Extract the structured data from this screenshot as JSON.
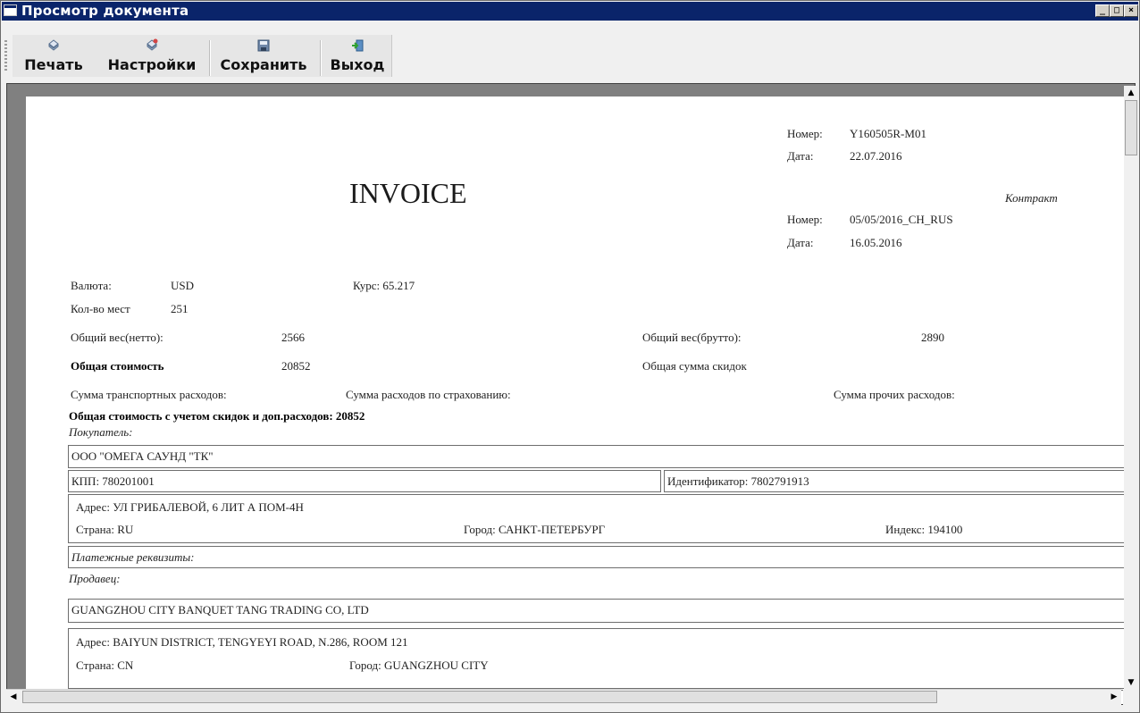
{
  "window": {
    "title": "Просмотр документа"
  },
  "toolbar": {
    "print": "Печать",
    "settings": "Настройки",
    "save": "Сохранить",
    "exit": "Выход"
  },
  "doc": {
    "title": "INVOICE",
    "number_label": "Номер:",
    "number": "Y160505R-M01",
    "date_label": "Дата:",
    "date": "22.07.2016",
    "contract_label": "Контракт",
    "contract_number_label": "Номер:",
    "contract_number": "05/05/2016_CH_RUS",
    "contract_date_label": "Дата:",
    "contract_date": "16.05.2016",
    "currency_label": "Валюта:",
    "currency": "USD",
    "rate": "Курс: 65.217",
    "places_label": "Кол-во мест",
    "places": "251",
    "net_weight_label": "Общий вес(нетто):",
    "net_weight": "2566",
    "gross_weight_label": "Общий вес(брутто):",
    "gross_weight": "2890",
    "total_cost_label": "Общая стоимость",
    "total_cost": "20852",
    "discounts_label": "Общая сумма скидок",
    "transport_label": "Сумма транспортных расходов:",
    "insurance_label": "Сумма расходов по страхованию:",
    "other_label": "Сумма прочих расходов:",
    "total_with_discounts": "Общая стоимость с учетом скидок и доп.расходов: 20852",
    "buyer_label": "Покупатель:",
    "buyer_name": "ООО \"ОМЕГА САУНД \"ТК\"",
    "buyer_kpp": "КПП: 780201001",
    "buyer_id": "Идентификатор: 7802791913",
    "buyer_address": "Адрес: УЛ ГРИБАЛЕВОЙ, 6 ЛИТ А ПОМ-4Н",
    "buyer_country": "Страна: RU",
    "buyer_city": "Город: САНКТ-ПЕТЕРБУРГ",
    "buyer_index": "Индекс: 194100",
    "payment_label": "Платежные реквизиты:",
    "seller_label": "Продавец:",
    "seller_name": "GUANGZHOU CITY BANQUET TANG TRADING CO, LTD",
    "seller_address": "Адрес: BAIYUN DISTRICT, TENGYEYI ROAD, N.286, ROOM 121",
    "seller_country": "Страна: CN",
    "seller_city": "Город: GUANGZHOU CITY"
  },
  "colors": {
    "titlebar": "#0a246a",
    "page": "#ffffff",
    "workspace": "#808080"
  }
}
